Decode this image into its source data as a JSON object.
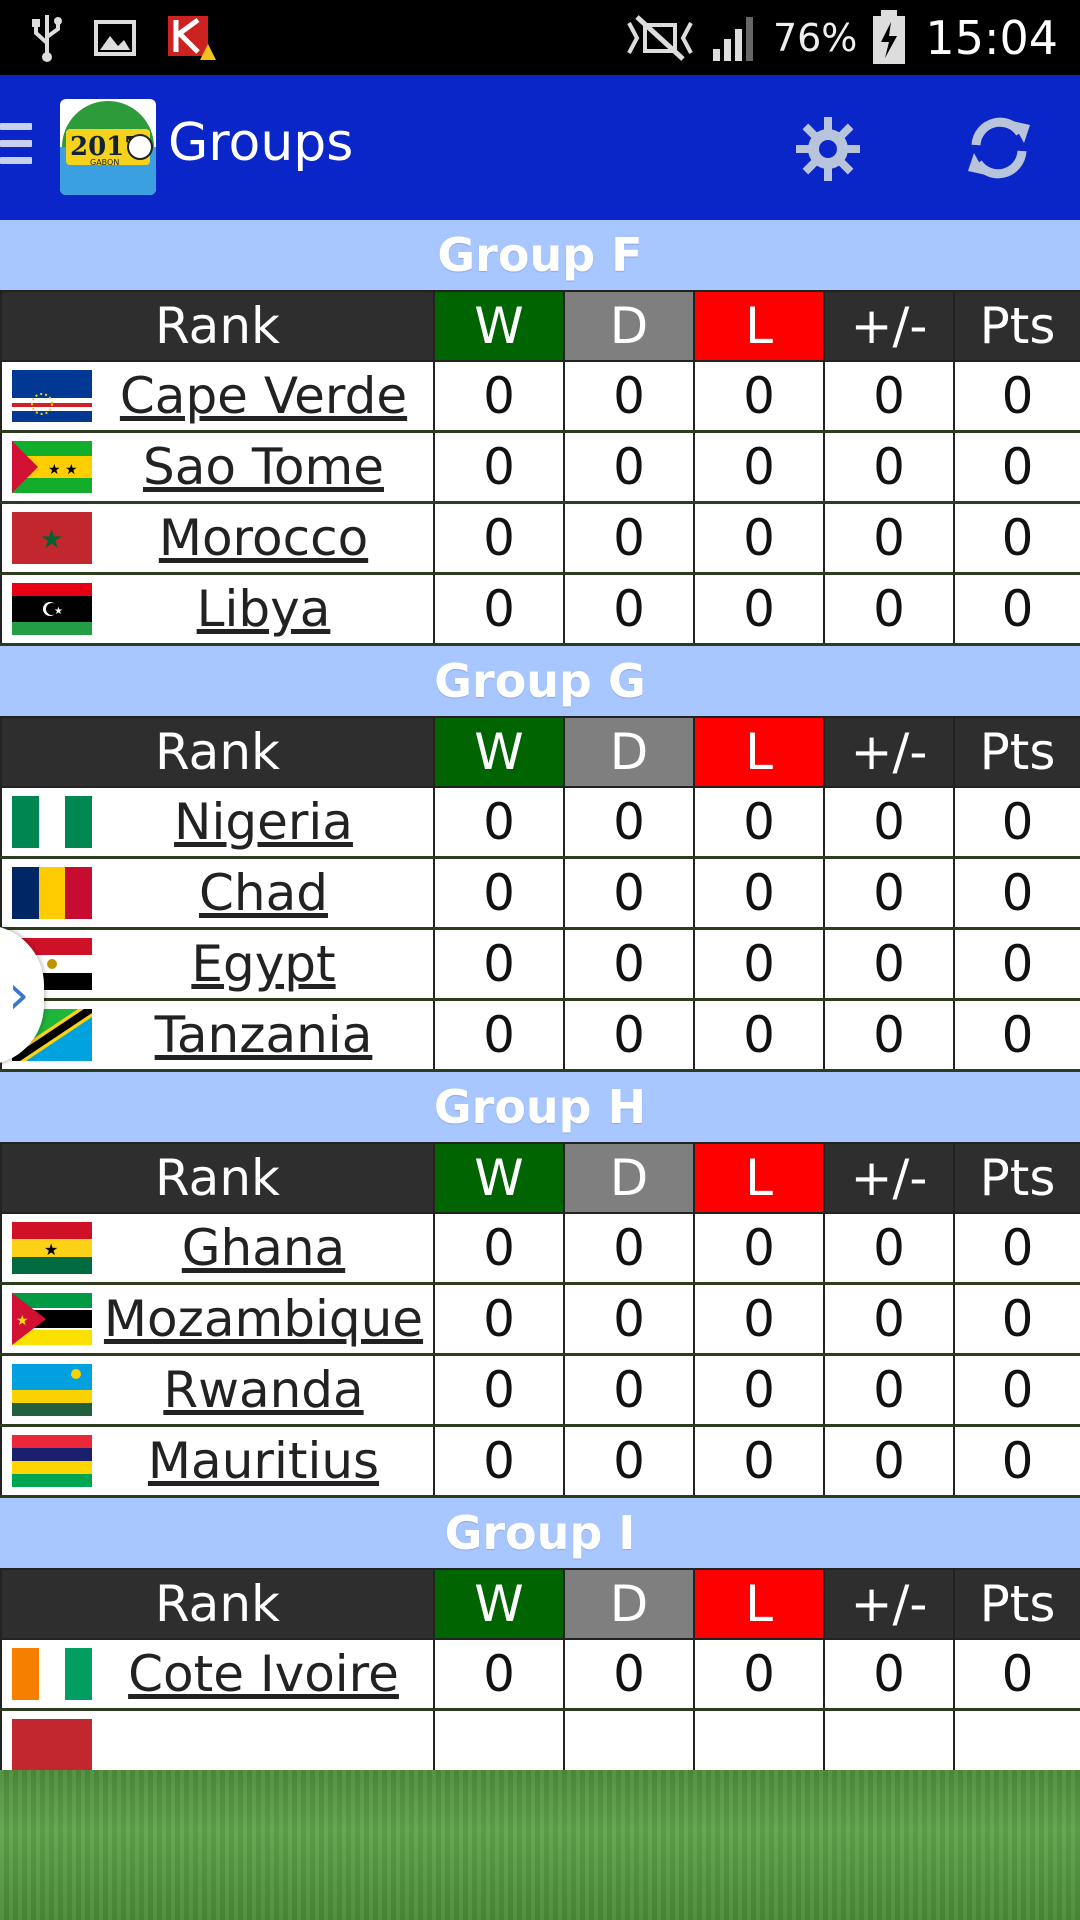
{
  "status_bar": {
    "battery_text": "76%",
    "clock": "15:04",
    "icons": [
      "usb-icon",
      "image-icon",
      "kaspersky-icon",
      "mute-icon",
      "signal-icon",
      "battery-charging-icon"
    ]
  },
  "app_bar": {
    "title": "Groups",
    "logo_text": "2017",
    "logo_subtext": "GABON"
  },
  "table_headers": [
    "Rank",
    "W",
    "D",
    "L",
    "+/-",
    "Pts"
  ],
  "groups": [
    {
      "name": "Group F",
      "teams": [
        {
          "name": "Cape Verde",
          "flag": "cape-verde",
          "stats": [
            "0",
            "0",
            "0",
            "0",
            "0"
          ]
        },
        {
          "name": "Sao Tome",
          "flag": "sao-tome",
          "stats": [
            "0",
            "0",
            "0",
            "0",
            "0"
          ]
        },
        {
          "name": "Morocco",
          "flag": "morocco",
          "stats": [
            "0",
            "0",
            "0",
            "0",
            "0"
          ]
        },
        {
          "name": "Libya",
          "flag": "libya",
          "stats": [
            "0",
            "0",
            "0",
            "0",
            "0"
          ]
        }
      ]
    },
    {
      "name": "Group G",
      "teams": [
        {
          "name": "Nigeria",
          "flag": "nigeria",
          "stats": [
            "0",
            "0",
            "0",
            "0",
            "0"
          ]
        },
        {
          "name": "Chad",
          "flag": "chad",
          "stats": [
            "0",
            "0",
            "0",
            "0",
            "0"
          ]
        },
        {
          "name": "Egypt",
          "flag": "egypt",
          "stats": [
            "0",
            "0",
            "0",
            "0",
            "0"
          ]
        },
        {
          "name": "Tanzania",
          "flag": "tanzania",
          "stats": [
            "0",
            "0",
            "0",
            "0",
            "0"
          ]
        }
      ]
    },
    {
      "name": "Group H",
      "teams": [
        {
          "name": "Ghana",
          "flag": "ghana",
          "stats": [
            "0",
            "0",
            "0",
            "0",
            "0"
          ]
        },
        {
          "name": "Mozambique",
          "flag": "mozambique",
          "stats": [
            "0",
            "0",
            "0",
            "0",
            "0"
          ]
        },
        {
          "name": "Rwanda",
          "flag": "rwanda",
          "stats": [
            "0",
            "0",
            "0",
            "0",
            "0"
          ]
        },
        {
          "name": "Mauritius",
          "flag": "mauritius",
          "stats": [
            "0",
            "0",
            "0",
            "0",
            "0"
          ]
        }
      ]
    },
    {
      "name": "Group I",
      "teams": [
        {
          "name": "Cote Ivoire",
          "flag": "cote-ivoire",
          "stats": [
            "0",
            "0",
            "0",
            "0",
            "0"
          ]
        },
        {
          "name": "",
          "flag": "partial-red",
          "stats": [
            "",
            "",
            "",
            "",
            ""
          ]
        }
      ]
    }
  ],
  "colors": {
    "app_bar": "#0a26c8",
    "group_header": "#a8c6ff",
    "win": "#006400",
    "draw": "#7f7f7f",
    "loss": "#ff0000",
    "header_dark": "#2e2e2e"
  }
}
